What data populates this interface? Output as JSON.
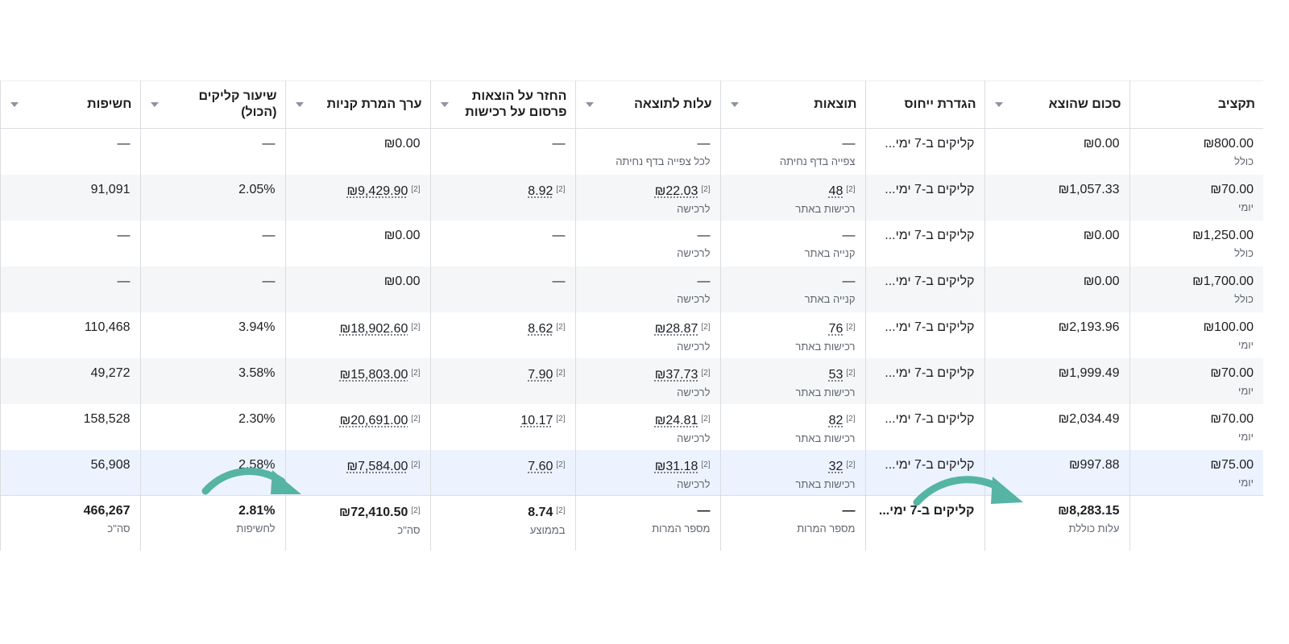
{
  "headers": {
    "budget": "תקציב",
    "spent": "סכום שהוצא",
    "attribution": "הגדרת ייחוס",
    "results": "תוצאות",
    "cost_per_result": "עלות לתוצאה",
    "roas": "החזר על הוצאות פרסום על רכישות",
    "conversion_value": "ערך המרת קניות",
    "ctr": "שיעור קליקים (הכול)",
    "impressions": "חשיפות"
  },
  "ref_mark": "[2]",
  "rows": [
    {
      "budget": "₪800.00",
      "budget_type": "כולל",
      "spent": "₪0.00",
      "attribution": "קליקים ב-7 ימי...",
      "results": "—",
      "results_type": "צפייה בדף נחיתה",
      "cpr": "—",
      "cpr_type": "לכל צפייה בדף נחיתה",
      "roas": "—",
      "conv": "₪0.00",
      "ctr": "—",
      "impr": "—"
    },
    {
      "budget": "₪70.00",
      "budget_type": "יומי",
      "spent": "₪1,057.33",
      "attribution": "קליקים ב-7 ימי...",
      "results": "48",
      "results_type": "רכישות באתר",
      "cpr": "₪22.03",
      "cpr_type": "לרכישה",
      "roas": "8.92",
      "conv": "₪9,429.90",
      "ctr": "2.05%",
      "impr": "91,091"
    },
    {
      "budget": "₪1,250.00",
      "budget_type": "כולל",
      "spent": "₪0.00",
      "attribution": "קליקים ב-7 ימי...",
      "results": "—",
      "results_type": "קנייה באתר",
      "cpr": "—",
      "cpr_type": "לרכישה",
      "roas": "—",
      "conv": "₪0.00",
      "ctr": "—",
      "impr": "—"
    },
    {
      "budget": "₪1,700.00",
      "budget_type": "כולל",
      "spent": "₪0.00",
      "attribution": "קליקים ב-7 ימי...",
      "results": "—",
      "results_type": "קנייה באתר",
      "cpr": "—",
      "cpr_type": "לרכישה",
      "roas": "—",
      "conv": "₪0.00",
      "ctr": "—",
      "impr": "—"
    },
    {
      "budget": "₪100.00",
      "budget_type": "יומי",
      "spent": "₪2,193.96",
      "attribution": "קליקים ב-7 ימי...",
      "results": "76",
      "results_type": "רכישות באתר",
      "cpr": "₪28.87",
      "cpr_type": "לרכישה",
      "roas": "8.62",
      "conv": "₪18,902.60",
      "ctr": "3.94%",
      "impr": "110,468"
    },
    {
      "budget": "₪70.00",
      "budget_type": "יומי",
      "spent": "₪1,999.49",
      "attribution": "קליקים ב-7 ימי...",
      "results": "53",
      "results_type": "רכישות באתר",
      "cpr": "₪37.73",
      "cpr_type": "לרכישה",
      "roas": "7.90",
      "conv": "₪15,803.00",
      "ctr": "3.58%",
      "impr": "49,272"
    },
    {
      "budget": "₪70.00",
      "budget_type": "יומי",
      "spent": "₪2,034.49",
      "attribution": "קליקים ב-7 ימי...",
      "results": "82",
      "results_type": "רכישות באתר",
      "cpr": "₪24.81",
      "cpr_type": "לרכישה",
      "roas": "10.17",
      "conv": "₪20,691.00",
      "ctr": "2.30%",
      "impr": "158,528"
    },
    {
      "budget": "₪75.00",
      "budget_type": "יומי",
      "spent": "₪997.88",
      "attribution": "קליקים ב-7 ימי...",
      "results": "32",
      "results_type": "רכישות באתר",
      "cpr": "₪31.18",
      "cpr_type": "לרכישה",
      "roas": "7.60",
      "conv": "₪7,584.00",
      "ctr": "2.58%",
      "impr": "56,908"
    }
  ],
  "totals": {
    "spent": "₪8,283.15",
    "spent_label": "עלות כוללת",
    "attribution": "קליקים ב-7 ימי...",
    "results": "—",
    "results_label": "מספר המרות",
    "cpr": "—",
    "cpr_label": "מספר המרות",
    "roas": "8.74",
    "roas_label": "בממוצע",
    "conv": "₪72,410.50",
    "conv_label": "סה\"כ",
    "ctr": "2.81%",
    "ctr_label": "לחשיפות",
    "impr": "466,267",
    "impr_label": "סה\"כ"
  },
  "colors": {
    "arrow": "#56b4a4",
    "selected_row": "#ecf3ff",
    "alt_row": "#f5f6f7",
    "border": "#dadde1"
  },
  "icons": {
    "sort": "sort-caret-icon",
    "annotation": "curved-arrow-icon"
  }
}
